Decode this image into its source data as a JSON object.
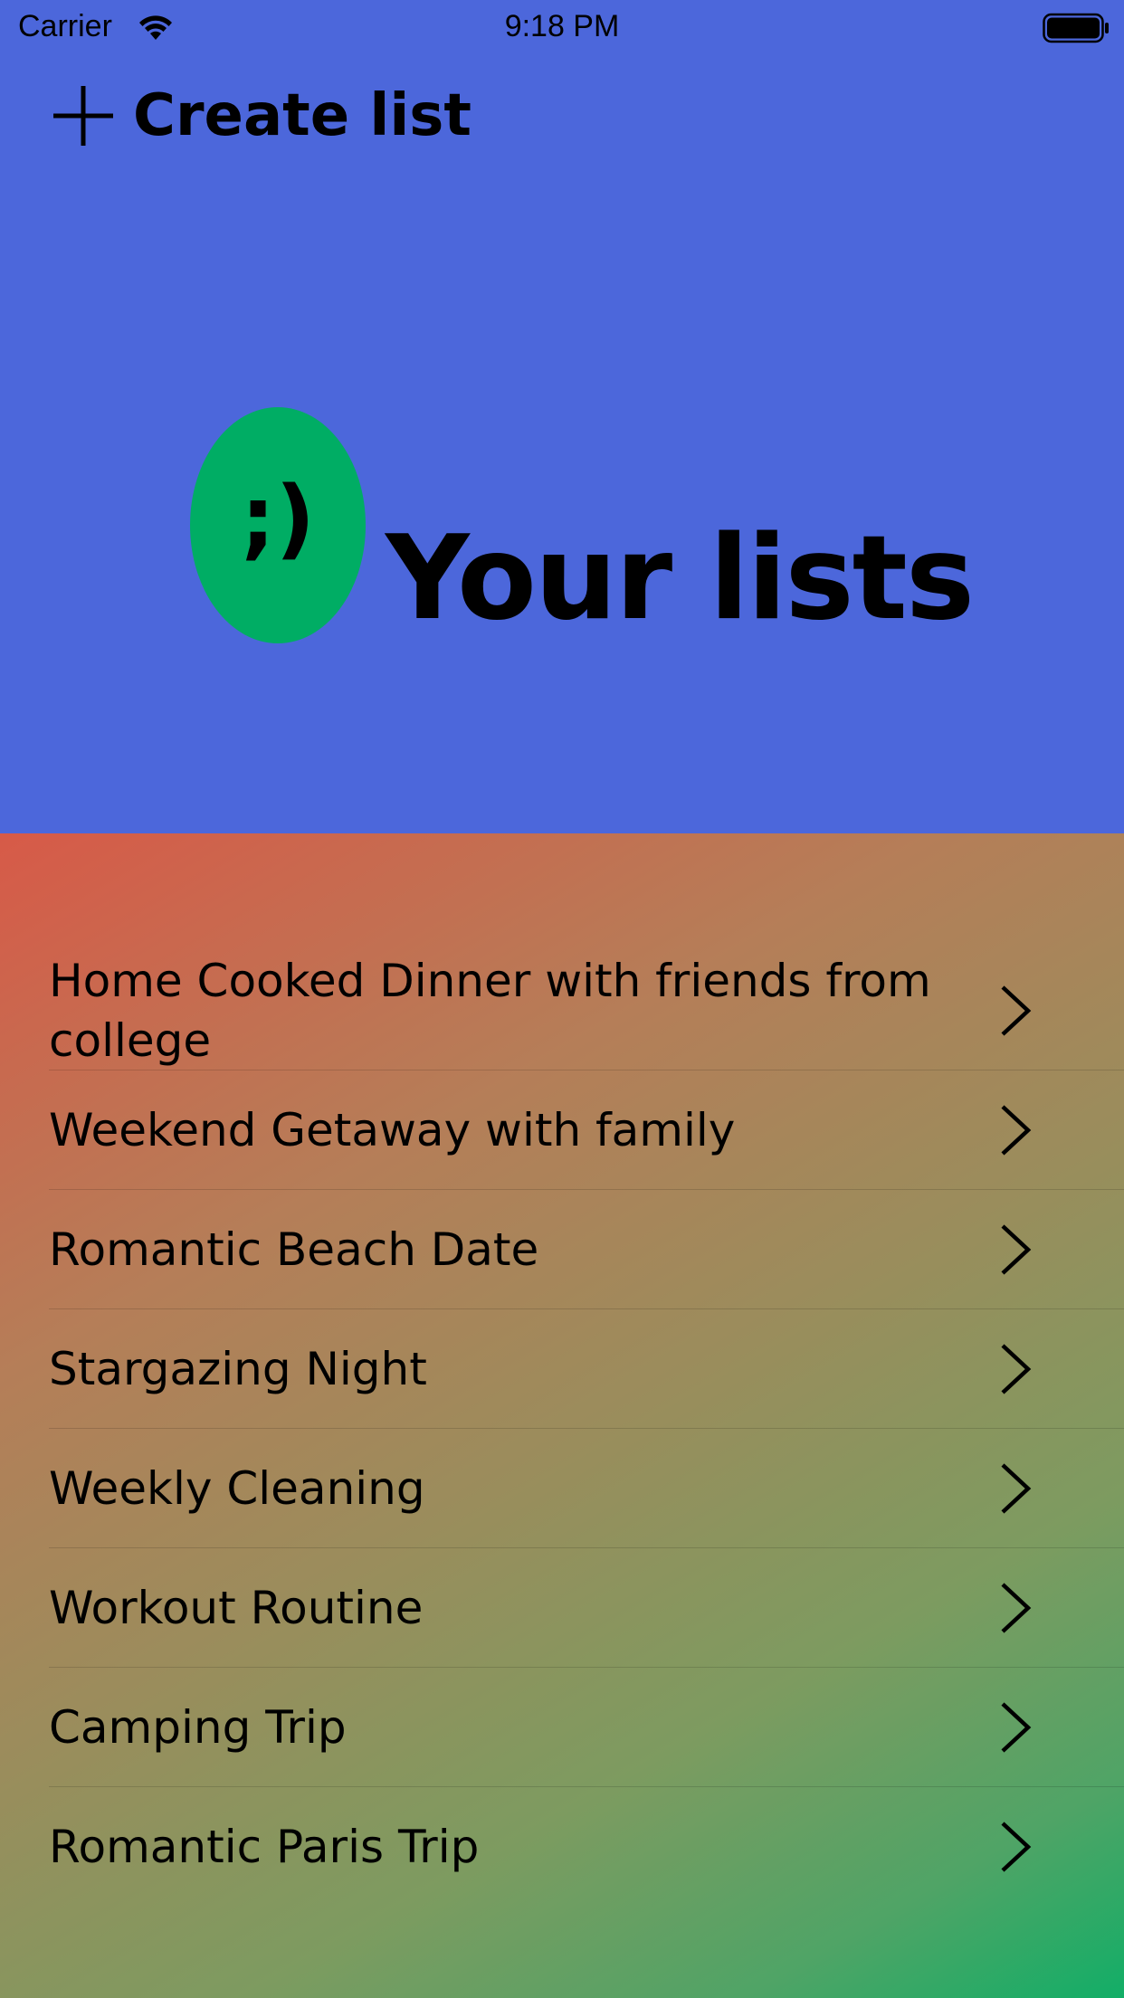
{
  "status_bar": {
    "carrier": "Carrier",
    "time": "9:18 PM",
    "wifi_icon": "wifi-icon",
    "battery_icon": "battery-icon"
  },
  "header": {
    "create_list_label": "Create list",
    "create_list_icon": "plus-icon"
  },
  "hero": {
    "logo_text": ";)",
    "title": "Your lists",
    "logo_color": "#00ad64",
    "background_color": "#4c67db"
  },
  "lists": {
    "gradient_colors": [
      "#d75a48",
      "#9a8d5c",
      "#12ae67"
    ],
    "items": [
      {
        "label": "Home Cooked Dinner with friends from college"
      },
      {
        "label": "Weekend Getaway with family"
      },
      {
        "label": "Romantic Beach Date"
      },
      {
        "label": "Stargazing Night"
      },
      {
        "label": "Weekly Cleaning"
      },
      {
        "label": "Workout Routine"
      },
      {
        "label": "Camping Trip"
      },
      {
        "label": "Romantic Paris Trip"
      }
    ]
  }
}
